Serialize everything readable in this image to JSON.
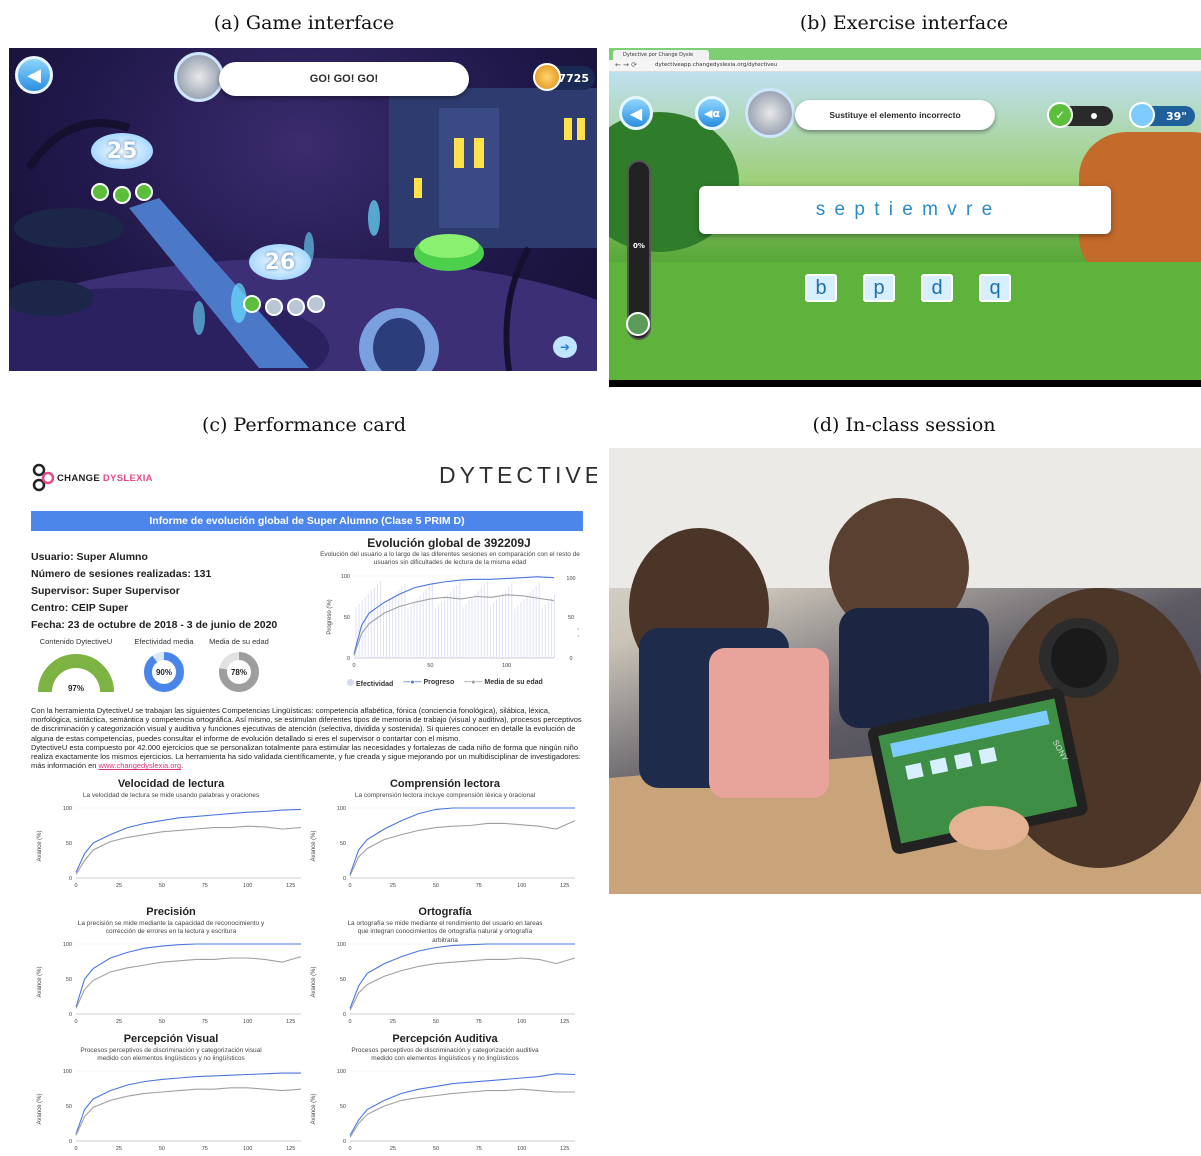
{
  "captions": {
    "a": "(a) Game interface",
    "b": "(b) Exercise interface",
    "c": "(c) Performance card",
    "d": "(d) In-class session"
  },
  "game": {
    "banner_text": "GO! GO! GO!",
    "coins": "7725",
    "level_a": "25",
    "level_b": "26"
  },
  "exercise": {
    "tab_title": "Dytective por Change Dysle",
    "url": "dytectiveapp.changedyslexia.org/dytectiveu",
    "instruction": "Sustituye el elemento incorrecto",
    "word": "s e p t i e m v r e",
    "timer": "39\"",
    "progress": "0%",
    "options": [
      "b",
      "p",
      "d",
      "q"
    ]
  },
  "card": {
    "brand_left": "CHANGE DYSLEXIA",
    "brand_left_1": "CHANGE",
    "brand_left_2": "DYSLEXIA",
    "brand_right": "DYTECTIVE",
    "header": "Informe de evolución global de Super Alumno (Clase 5 PRIM D)",
    "info": [
      "Usuario: Super Alumno",
      "Número de sesiones realizadas: 131",
      "Supervisor: Super Supervisor",
      "Centro: CEIP Super",
      "Fecha: 23 de octubre de 2018 - 3 de junio de 2020"
    ],
    "gauges": [
      {
        "label": "Contenido DytectiveU",
        "value": "97%",
        "fraction": 0.97,
        "color": "#7cb342"
      },
      {
        "label": "Efectividad media",
        "value": "90%",
        "fraction": 0.9,
        "color": "#4a86e8"
      },
      {
        "label": "Media de su edad",
        "value": "78%",
        "fraction": 0.78,
        "color": "#9e9e9e"
      }
    ],
    "global_title": "Evolución global de 392209J",
    "global_sub": "Evolución del usuario a lo largo de las diferentes sesiones en comparación con el resto de usuarios sin dificultades de lectura de la misma edad",
    "global_ylabel_left": "Progreso (%)",
    "global_ylabel_right": "Efectividad (%)",
    "legend": [
      "Efectividad",
      "Progreso",
      "Media de su edad"
    ],
    "paragraph_1": "Con la herramienta DytectiveU se trabajan las siguientes Competencias Lingüísticas: competencia alfabética, fónica (conciencia fonológica), silábica, léxica, morfológica, sintáctica, semántica y competencia ortográfica. Así mismo, se estimulan diferentes tipos de memoria de trabajo (visual y auditiva), procesos perceptivos de discriminación y categorización visual y auditiva y funciones ejecutivas de atención (selectiva, dividida y sostenida). Si quieres conocer en detalle la evolución de alguna de estas competencias, puedes consultar el informe de evolución detallado si eres el supervisor o contartar con el mismo.",
    "paragraph_2a": "DytectiveU esta compuesto por 42.000 ejercicios que se personalizan totalmente para estimular las necesidades y fortalezas de cada niño de forma que ningún niño realiza exactamente los mismos ejercicios. La herramienta ha sido validada científicamente, y fue creada y sigue mejorando por un multidisciplinar de investigadores: más información en ",
    "link": "www.changedyslexia.org",
    "paragraph_2b": ".",
    "y_axis_label": "Avance (%)",
    "small_charts": [
      {
        "title": "Velocidad de lectura",
        "sub": "La velocidad de lectura se mide usando palabras y oraciones"
      },
      {
        "title": "Comprensión lectora",
        "sub": "La comprensión lectora incluye comprensión léxica y oracional"
      },
      {
        "title": "Precisión",
        "sub": "La precisión se mide mediante la capacidad de reconocimiento y corrección de errores en la lectura y escritura"
      },
      {
        "title": "Ortografía",
        "sub": "La ortografía se mide mediante el rendimiento del usuario en tareas que integran conocimientos de ortografía natural y ortografía arbitraria"
      },
      {
        "title": "Percepción Visual",
        "sub": "Procesos perceptivos de discriminación y categorización visual medido con elementos lingüísticos y no lingüísticos"
      },
      {
        "title": "Percepción Auditiva",
        "sub": "Procesos perceptivos de discriminación y categorización auditiva medido con elementos lingüísticos y no lingüísticos"
      }
    ]
  },
  "photo": {
    "headphone_brand": "SONY"
  },
  "chart_data": [
    {
      "type": "line",
      "title": "Evolución global de 392209J",
      "x_ticks": [
        0,
        50,
        100
      ],
      "y_ticks": [
        0,
        50,
        100
      ],
      "ylim": [
        0,
        100
      ],
      "xlim": [
        0,
        131
      ],
      "series": [
        {
          "name": "Progreso",
          "x": [
            0,
            5,
            10,
            20,
            30,
            40,
            50,
            60,
            70,
            80,
            90,
            100,
            110,
            120,
            131
          ],
          "values": [
            5,
            40,
            55,
            68,
            78,
            86,
            90,
            93,
            95,
            96,
            96,
            97,
            98,
            99,
            98
          ]
        },
        {
          "name": "Media de su edad",
          "x": [
            0,
            5,
            10,
            20,
            30,
            40,
            50,
            60,
            70,
            80,
            90,
            100,
            110,
            120,
            131
          ],
          "values": [
            3,
            30,
            42,
            55,
            63,
            68,
            72,
            74,
            72,
            75,
            74,
            77,
            76,
            73,
            70
          ]
        }
      ],
      "effectiveness_bars": true,
      "legend_position": "bottom"
    },
    {
      "type": "line",
      "title": "Velocidad de lectura",
      "x_ticks": [
        0,
        25,
        50,
        75,
        100,
        125
      ],
      "y_ticks": [
        0,
        50,
        100
      ],
      "series": [
        {
          "x": [
            0,
            5,
            10,
            20,
            30,
            40,
            50,
            60,
            70,
            80,
            90,
            100,
            110,
            120,
            131
          ],
          "values": [
            8,
            35,
            50,
            62,
            72,
            78,
            82,
            86,
            88,
            90,
            92,
            94,
            95,
            97,
            98
          ]
        },
        {
          "x": [
            0,
            5,
            10,
            20,
            30,
            40,
            50,
            60,
            70,
            80,
            90,
            100,
            110,
            120,
            131
          ],
          "values": [
            5,
            25,
            40,
            52,
            58,
            62,
            66,
            68,
            70,
            72,
            72,
            74,
            73,
            70,
            72
          ]
        }
      ]
    },
    {
      "type": "line",
      "title": "Comprensión lectora",
      "x_ticks": [
        0,
        25,
        50,
        75,
        100,
        125
      ],
      "y_ticks": [
        0,
        50,
        100
      ],
      "series": [
        {
          "x": [
            0,
            5,
            10,
            20,
            30,
            40,
            50,
            60,
            70,
            80,
            90,
            100,
            110,
            120,
            131
          ],
          "values": [
            5,
            40,
            55,
            70,
            82,
            92,
            98,
            100,
            100,
            100,
            100,
            100,
            100,
            100,
            100
          ]
        },
        {
          "x": [
            0,
            5,
            10,
            20,
            30,
            40,
            50,
            60,
            70,
            80,
            90,
            100,
            110,
            120,
            131
          ],
          "values": [
            3,
            30,
            42,
            55,
            62,
            68,
            72,
            74,
            75,
            78,
            78,
            76,
            74,
            70,
            82
          ]
        }
      ]
    },
    {
      "type": "line",
      "title": "Precisión",
      "x_ticks": [
        0,
        25,
        50,
        75,
        100,
        125
      ],
      "y_ticks": [
        0,
        50,
        100
      ],
      "series": [
        {
          "x": [
            0,
            5,
            10,
            20,
            30,
            40,
            50,
            60,
            70,
            80,
            90,
            100,
            110,
            120,
            131
          ],
          "values": [
            10,
            50,
            65,
            80,
            88,
            94,
            97,
            99,
            100,
            100,
            100,
            100,
            100,
            100,
            100
          ]
        },
        {
          "x": [
            0,
            5,
            10,
            20,
            30,
            40,
            50,
            60,
            70,
            80,
            90,
            100,
            110,
            120,
            131
          ],
          "values": [
            8,
            35,
            48,
            60,
            66,
            70,
            74,
            76,
            78,
            78,
            80,
            80,
            78,
            74,
            82
          ]
        }
      ]
    },
    {
      "type": "line",
      "title": "Ortografía",
      "x_ticks": [
        0,
        25,
        50,
        75,
        100,
        125
      ],
      "y_ticks": [
        0,
        50,
        100
      ],
      "series": [
        {
          "x": [
            0,
            5,
            10,
            20,
            30,
            40,
            50,
            60,
            70,
            80,
            90,
            100,
            110,
            120,
            131
          ],
          "values": [
            8,
            40,
            58,
            72,
            82,
            90,
            95,
            98,
            99,
            100,
            100,
            100,
            100,
            100,
            100
          ]
        },
        {
          "x": [
            0,
            5,
            10,
            20,
            30,
            40,
            50,
            60,
            70,
            80,
            90,
            100,
            110,
            120,
            131
          ],
          "values": [
            5,
            30,
            42,
            54,
            62,
            68,
            72,
            74,
            76,
            78,
            78,
            80,
            78,
            72,
            80
          ]
        }
      ]
    },
    {
      "type": "line",
      "title": "Percepción Visual",
      "x_ticks": [
        0,
        25,
        50,
        75,
        100,
        125
      ],
      "y_ticks": [
        0,
        50,
        100
      ],
      "series": [
        {
          "x": [
            0,
            5,
            10,
            20,
            30,
            40,
            50,
            60,
            70,
            80,
            90,
            100,
            110,
            120,
            131
          ],
          "values": [
            10,
            45,
            60,
            72,
            80,
            85,
            88,
            90,
            92,
            93,
            94,
            95,
            96,
            97,
            97
          ]
        },
        {
          "x": [
            0,
            5,
            10,
            20,
            30,
            40,
            50,
            60,
            70,
            80,
            90,
            100,
            110,
            120,
            131
          ],
          "values": [
            8,
            35,
            48,
            58,
            64,
            68,
            70,
            72,
            74,
            74,
            76,
            76,
            74,
            72,
            74
          ]
        }
      ]
    },
    {
      "type": "line",
      "title": "Percepción Auditiva",
      "x_ticks": [
        0,
        25,
        50,
        75,
        100,
        125
      ],
      "y_ticks": [
        0,
        50,
        100
      ],
      "series": [
        {
          "x": [
            0,
            5,
            10,
            20,
            30,
            40,
            50,
            60,
            70,
            80,
            90,
            100,
            110,
            120,
            131
          ],
          "values": [
            8,
            30,
            45,
            58,
            68,
            74,
            78,
            82,
            84,
            86,
            88,
            90,
            92,
            96,
            95
          ]
        },
        {
          "x": [
            0,
            5,
            10,
            20,
            30,
            40,
            50,
            60,
            70,
            80,
            90,
            100,
            110,
            120,
            131
          ],
          "values": [
            5,
            25,
            38,
            50,
            58,
            62,
            65,
            68,
            70,
            72,
            72,
            74,
            72,
            70,
            70
          ]
        }
      ]
    }
  ]
}
